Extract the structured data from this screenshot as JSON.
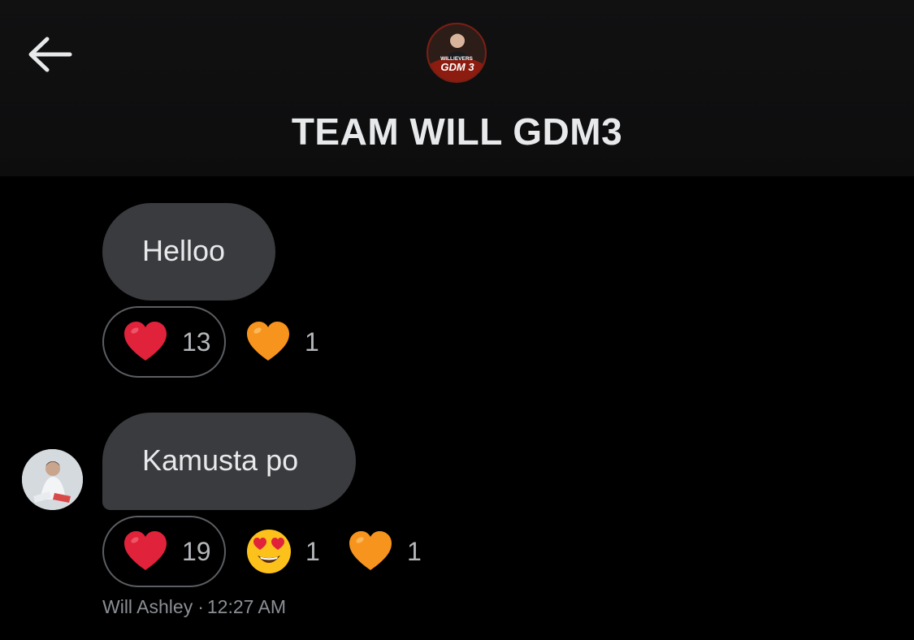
{
  "header": {
    "title": "TEAM WILL GDM3",
    "back_icon": "arrow-left-icon",
    "avatar_text_top": "WILLIEVERS",
    "avatar_text_bottom": "GDM 3"
  },
  "messages": [
    {
      "text": "Helloo",
      "reactions": [
        {
          "emoji": "red-heart-icon",
          "count": "13",
          "selected": true
        },
        {
          "emoji": "orange-heart-icon",
          "count": "1",
          "selected": false
        }
      ]
    },
    {
      "text": "Kamusta po",
      "reactions": [
        {
          "emoji": "red-heart-icon",
          "count": "19",
          "selected": true
        },
        {
          "emoji": "heart-eyes-icon",
          "count": "1",
          "selected": false
        },
        {
          "emoji": "orange-heart-icon",
          "count": "1",
          "selected": false
        }
      ],
      "sender": "Will Ashley",
      "separator": "·",
      "time": "12:27 AM"
    }
  ],
  "colors": {
    "background": "#000000",
    "bubble": "#3a3b3e",
    "text": "#e7e9ea",
    "muted": "#8b8f94",
    "red_heart": "#e0223a",
    "orange_heart": "#f7941d"
  }
}
